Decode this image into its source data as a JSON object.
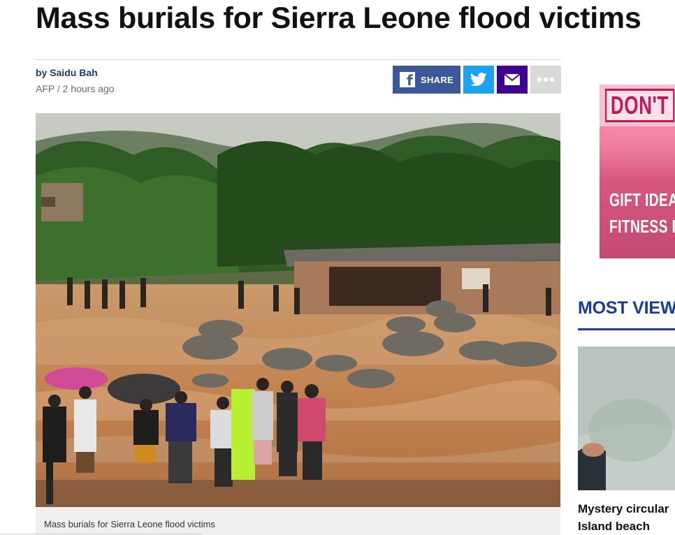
{
  "article": {
    "headline": "Mass burials for Sierra Leone flood victims",
    "byline_prefix": "by",
    "author": "Saidu Bah",
    "source_time": "AFP / 2 hours ago",
    "photo_caption": "Mass burials for Sierra Leone flood victims"
  },
  "share": {
    "facebook_label": "SHARE",
    "facebook_icon": "facebook-icon",
    "twitter_icon": "twitter-icon",
    "email_icon": "mail-icon",
    "more_icon": "more-dots-icon",
    "colors": {
      "facebook": "#3b5998",
      "twitter": "#1da1f2",
      "email": "#400090",
      "more": "#d9d9d9"
    }
  },
  "ad": {
    "headline": "DON'T",
    "line1": "GIFT IDEA",
    "line2": "FITNESS E"
  },
  "most_viewed": {
    "heading": "MOST VIEW",
    "item_title_line1": "Mystery circular",
    "item_title_line2": "Island beach"
  },
  "colors": {
    "link_blue": "#1b3a7a",
    "section_blue": "#1b3a9a"
  }
}
